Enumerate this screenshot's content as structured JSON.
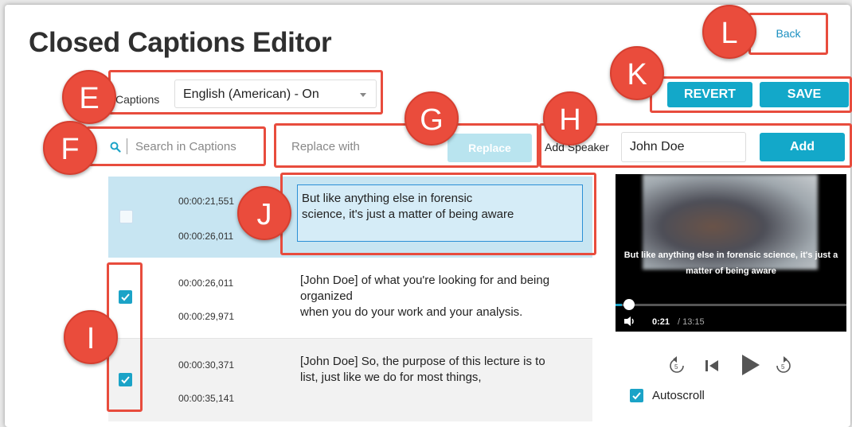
{
  "page": {
    "title": "Closed Captions Editor"
  },
  "header": {
    "back_label": "Back",
    "revert_label": "REVERT",
    "save_label": "SAVE"
  },
  "captions_select": {
    "label": "Captions",
    "value": "English (American) - On"
  },
  "search": {
    "placeholder": "Search in Captions"
  },
  "replace": {
    "placeholder": "Replace with",
    "button_label": "Replace"
  },
  "speaker": {
    "label": "Add Speaker",
    "value": "John Doe",
    "add_label": "Add"
  },
  "callouts": {
    "E": "E",
    "F": "F",
    "G": "G",
    "H": "H",
    "I": "I",
    "J": "J",
    "K": "K",
    "L": "L"
  },
  "captions": [
    {
      "start": "00:00:21,551",
      "end": "00:00:26,011",
      "text_line1": "But like anything else in forensic",
      "text_line2": "science, it's just a matter of being aware",
      "text_line3": "",
      "checked": false,
      "selected": true
    },
    {
      "start": "00:00:26,011",
      "end": "00:00:29,971",
      "text_line1": "[John Doe] of what you're looking for and being",
      "text_line2": "organized",
      "text_line3": "when you do your work and your analysis.",
      "checked": true,
      "selected": false
    },
    {
      "start": "00:00:30,371",
      "end": "00:00:35,141",
      "text_line1": "[John Doe] So, the purpose of this lecture is to",
      "text_line2": "list, just like we do for most things,",
      "text_line3": "",
      "checked": true,
      "selected": false
    }
  ],
  "video": {
    "subtitle_line1": "But like anything else in forensic science, it's just a",
    "subtitle_line2": "matter of being aware",
    "current_time": "0:21",
    "total_time": "/ 13:15",
    "progress_fraction": 0.027
  },
  "autoscroll": {
    "label": "Autoscroll",
    "checked": true
  },
  "colors": {
    "accent": "#13a8c9",
    "callout": "#ea4c3c",
    "selected_row": "#c7e5f2"
  }
}
